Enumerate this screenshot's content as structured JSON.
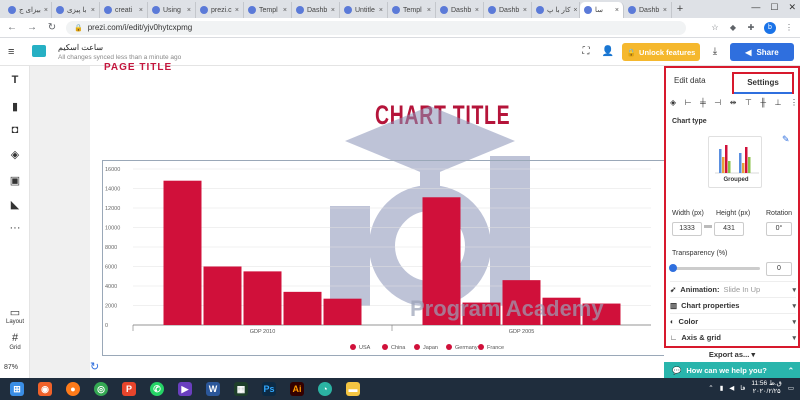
{
  "browser": {
    "tabs": [
      {
        "label": "بیزای ج",
        "x": "×"
      },
      {
        "label": "با پیزی",
        "x": "×"
      },
      {
        "label": "creati",
        "x": "×"
      },
      {
        "label": "Using",
        "x": "×"
      },
      {
        "label": "prezi.c",
        "x": "×"
      },
      {
        "label": "Templ",
        "x": "×"
      },
      {
        "label": "Dashb",
        "x": "×"
      },
      {
        "label": "Untitle",
        "x": "×"
      },
      {
        "label": "Templ",
        "x": "×"
      },
      {
        "label": "Dashb",
        "x": "×"
      },
      {
        "label": "Dashb",
        "x": "×"
      },
      {
        "label": "کار با پ",
        "x": "×"
      },
      {
        "label": "سا",
        "x": "×"
      },
      {
        "label": "Dashb",
        "x": "×"
      }
    ],
    "new_tab": "+",
    "url": "prezi.com/i/edit/yjv0hytcxpmg",
    "profile_initial": "b"
  },
  "header": {
    "menu_glyph": "≡",
    "doc_title": "ساعت اسکیم",
    "doc_status": "All changes synced less than a minute ago",
    "unlock_label": "Unlock features",
    "share_label": "Share"
  },
  "left_tools": {
    "layout_label": "Layout",
    "grid_label": "Grid",
    "zoom_label": "87%"
  },
  "slide": {
    "fragment_title": "PAGE TITLE",
    "watermark_text": "Program Academy"
  },
  "chart_data": {
    "type": "bar",
    "title": "CHART TITLE",
    "categories": [
      "GDP 2010",
      "GDP 2005"
    ],
    "ylim": [
      0,
      16000
    ],
    "yticks": [
      "0",
      "2000",
      "4000",
      "6000",
      "8000",
      "10000",
      "12000",
      "14000",
      "16000"
    ],
    "series": [
      {
        "name": "USA",
        "values": [
          14800,
          13100
        ]
      },
      {
        "name": "China",
        "values": [
          6000,
          2300
        ]
      },
      {
        "name": "Japan",
        "values": [
          5500,
          4600
        ]
      },
      {
        "name": "Germany",
        "values": [
          3400,
          2800
        ]
      },
      {
        "name": "France",
        "values": [
          2700,
          2200
        ]
      }
    ],
    "colors": [
      "#d0103a",
      "#d0103a",
      "#d0103a",
      "#d0103a",
      "#d0103a"
    ],
    "grid": true,
    "legend": "bottom"
  },
  "panel": {
    "tab_edit": "Edit data",
    "tab_settings": "Settings",
    "chart_type_label": "Chart type",
    "chart_type_name": "Grouped",
    "width_label": "Width (px)",
    "height_label": "Height (px)",
    "rotation_label": "Rotation",
    "width_value": "1333",
    "height_value": "431",
    "rotation_value": "0°",
    "transparency_label": "Transparency (%)",
    "transparency_value": "0",
    "animation_label": "Animation:",
    "animation_value": "Slide In Up",
    "chart_props_label": "Chart properties",
    "color_label": "Color",
    "axis_grid_label": "Axis & grid",
    "export_label": "Export as...",
    "help_label": "How can we help you?"
  },
  "taskbar": {
    "time": "11:56 ق.ظ",
    "date": "۲۰۲۰/۲/۲۵",
    "lang": "فا"
  }
}
